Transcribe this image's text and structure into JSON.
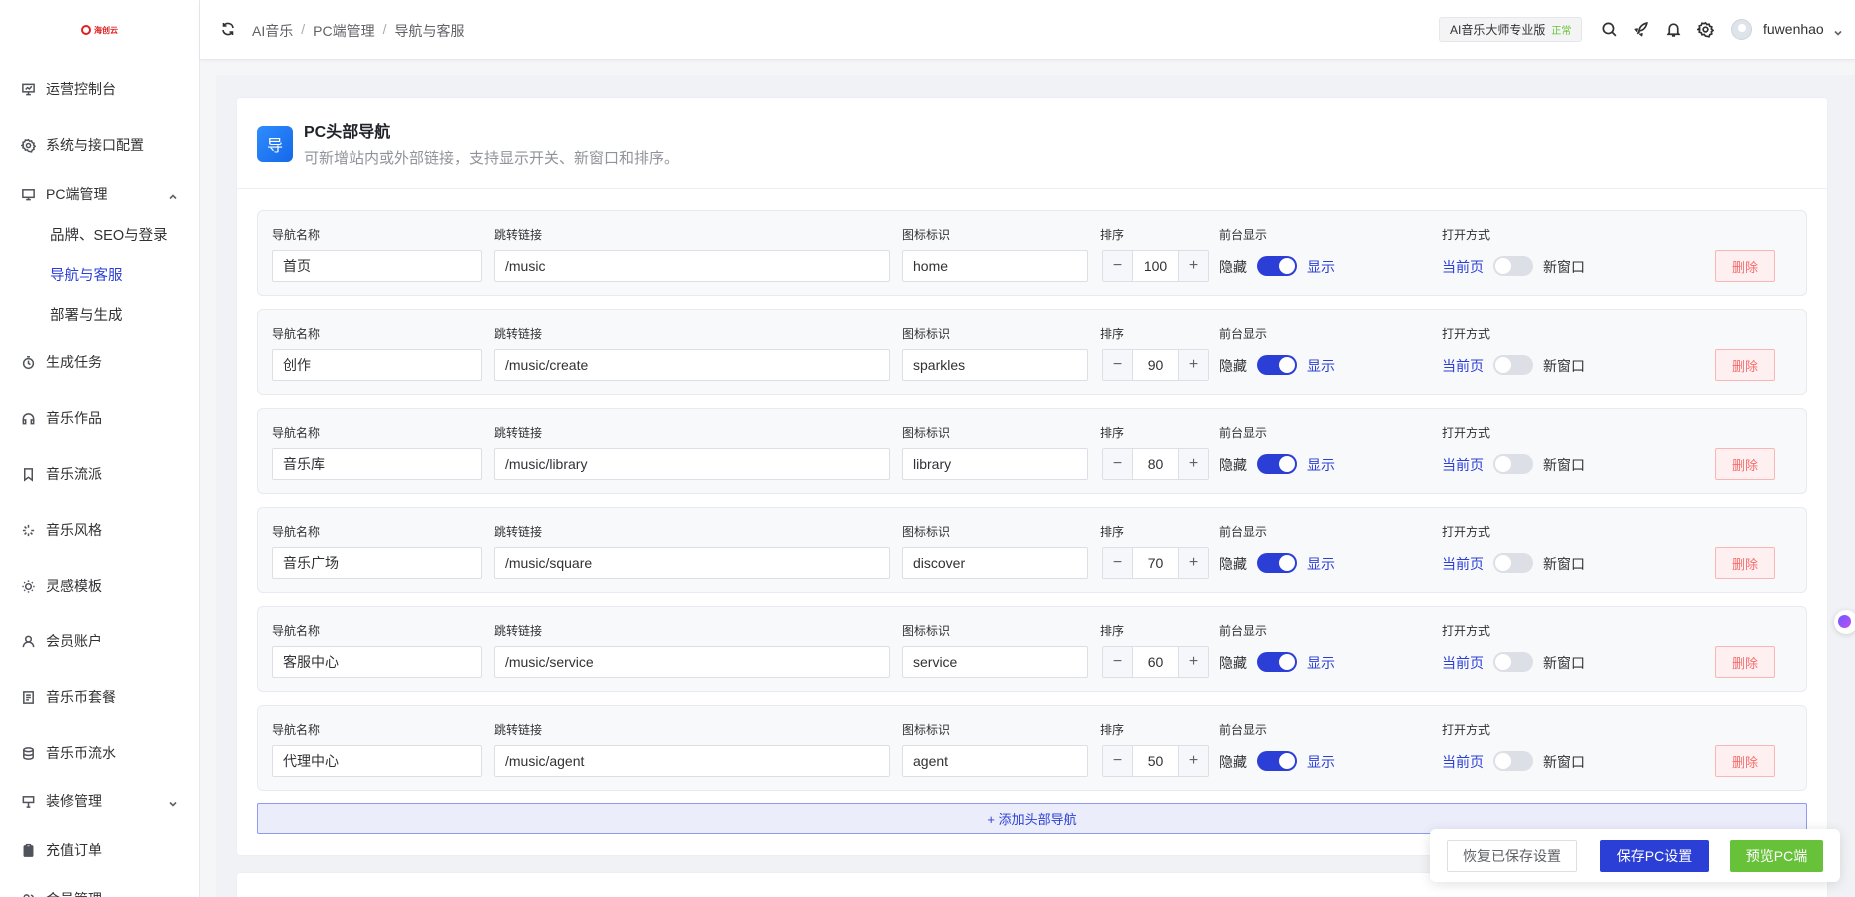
{
  "logo": {
    "text": "海创云"
  },
  "sidebar": {
    "items": [
      {
        "label": "运营控制台",
        "icon": "monitor-chart-icon"
      },
      {
        "label": "系统与接口配置",
        "icon": "gear-icon"
      },
      {
        "label": "PC端管理",
        "icon": "desktop-icon",
        "expanded": true
      },
      {
        "label": "生成任务",
        "icon": "timer-icon"
      },
      {
        "label": "音乐作品",
        "icon": "headphones-icon"
      },
      {
        "label": "音乐流派",
        "icon": "bookmark-icon"
      },
      {
        "label": "音乐风格",
        "icon": "sparkle-icon"
      },
      {
        "label": "灵感模板",
        "icon": "sun-icon"
      },
      {
        "label": "会员账户",
        "icon": "user-icon"
      },
      {
        "label": "音乐币套餐",
        "icon": "document-icon"
      },
      {
        "label": "音乐币流水",
        "icon": "database-icon"
      },
      {
        "label": "装修管理",
        "icon": "brush-icon",
        "expanded": false
      },
      {
        "label": "充值订单",
        "icon": "clipboard-icon"
      },
      {
        "label": "会员管理",
        "icon": "users-icon",
        "expanded": false
      }
    ],
    "sub_items": [
      {
        "label": "品牌、SEO与登录"
      },
      {
        "label": "导航与客服",
        "active": true
      },
      {
        "label": "部署与生成"
      }
    ]
  },
  "header": {
    "breadcrumb": [
      "AI音乐",
      "PC端管理",
      "导航与客服"
    ],
    "edition": "AI音乐大师专业版",
    "edition_status": "正常",
    "username": "fuwenhao"
  },
  "card": {
    "icon_char": "导",
    "title": "PC头部导航",
    "description": "可新增站内或外部链接，支持显示开关、新窗口和排序。",
    "labels": {
      "name": "导航名称",
      "link": "跳转链接",
      "icon": "图标标识",
      "sort": "排序",
      "display": "前台显示",
      "open_mode": "打开方式"
    },
    "text": {
      "hide": "隐藏",
      "show": "显示",
      "current_page": "当前页",
      "new_window": "新窗口",
      "delete": "删除",
      "add": "+ 添加头部导航"
    },
    "rows": [
      {
        "name": "首页",
        "link": "/music",
        "icon": "home",
        "sort": "100",
        "display": true,
        "new_window": false
      },
      {
        "name": "创作",
        "link": "/music/create",
        "icon": "sparkles",
        "sort": "90",
        "display": true,
        "new_window": false
      },
      {
        "name": "音乐库",
        "link": "/music/library",
        "icon": "library",
        "sort": "80",
        "display": true,
        "new_window": false
      },
      {
        "name": "音乐广场",
        "link": "/music/square",
        "icon": "discover",
        "sort": "70",
        "display": true,
        "new_window": false
      },
      {
        "name": "客服中心",
        "link": "/music/service",
        "icon": "service",
        "sort": "60",
        "display": true,
        "new_window": false
      },
      {
        "name": "代理中心",
        "link": "/music/agent",
        "icon": "agent",
        "sort": "50",
        "display": true,
        "new_window": false
      }
    ]
  },
  "actions": {
    "restore": "恢复已保存设置",
    "save": "保存PC设置",
    "preview": "预览PC端"
  },
  "colors": {
    "primary": "#2b3fd6",
    "success": "#67c23a",
    "danger": "#f56c6c"
  }
}
